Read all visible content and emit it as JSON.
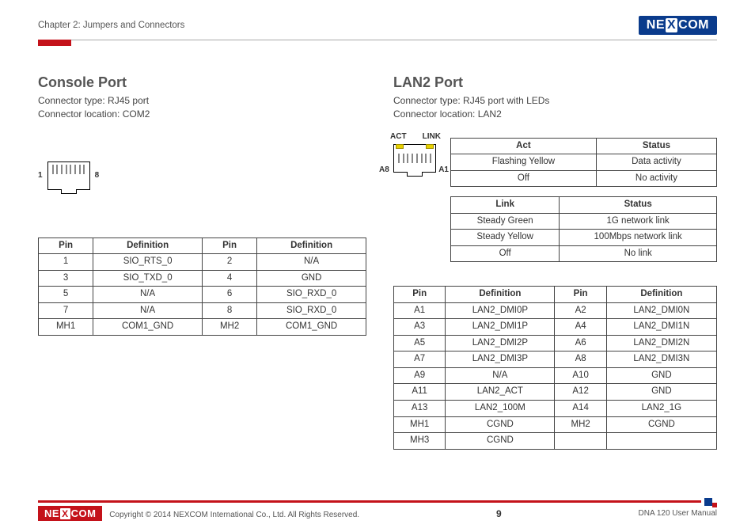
{
  "header": {
    "chapter": "Chapter 2: Jumpers and Connectors",
    "brand": "NEXCOM"
  },
  "console": {
    "title": "Console Port",
    "type": "Connector type: RJ45 port",
    "loc": "Connector location: COM2",
    "pin_left": "1",
    "pin_right": "8",
    "cols": [
      "Pin",
      "Definition",
      "Pin",
      "Definition"
    ],
    "rows": [
      [
        "1",
        "SIO_RTS_0",
        "2",
        "N/A"
      ],
      [
        "3",
        "SIO_TXD_0",
        "4",
        "GND"
      ],
      [
        "5",
        "N/A",
        "6",
        "SIO_RXD_0"
      ],
      [
        "7",
        "N/A",
        "8",
        "SIO_RXD_0"
      ],
      [
        "MH1",
        "COM1_GND",
        "MH2",
        "COM1_GND"
      ]
    ]
  },
  "lan": {
    "title": "LAN2 Port",
    "type": "Connector type: RJ45 port with LEDs",
    "loc": "Connector location: LAN2",
    "lbl_act": "ACT",
    "lbl_link": "LINK",
    "lbl_a8": "A8",
    "lbl_a1": "A1",
    "act_cols": [
      "Act",
      "Status"
    ],
    "act_rows": [
      [
        "Flashing Yellow",
        "Data activity"
      ],
      [
        "Off",
        "No activity"
      ]
    ],
    "link_cols": [
      "Link",
      "Status"
    ],
    "link_rows": [
      [
        "Steady Green",
        "1G network link"
      ],
      [
        "Steady Yellow",
        "100Mbps network link"
      ],
      [
        "Off",
        "No link"
      ]
    ],
    "pin_cols": [
      "Pin",
      "Definition",
      "Pin",
      "Definition"
    ],
    "pin_rows": [
      [
        "A1",
        "LAN2_DMI0P",
        "A2",
        "LAN2_DMI0N"
      ],
      [
        "A3",
        "LAN2_DMI1P",
        "A4",
        "LAN2_DMI1N"
      ],
      [
        "A5",
        "LAN2_DMI2P",
        "A6",
        "LAN2_DMI2N"
      ],
      [
        "A7",
        "LAN2_DMI3P",
        "A8",
        "LAN2_DMI3N"
      ],
      [
        "A9",
        "N/A",
        "A10",
        "GND"
      ],
      [
        "A11",
        "LAN2_ACT",
        "A12",
        "GND"
      ],
      [
        "A13",
        "LAN2_100M",
        "A14",
        "LAN2_1G"
      ],
      [
        "MH1",
        "CGND",
        "MH2",
        "CGND"
      ],
      [
        "MH3",
        "CGND",
        "",
        ""
      ]
    ]
  },
  "footer": {
    "copyright": "Copyright © 2014 NEXCOM International Co., Ltd. All Rights Reserved.",
    "page": "9",
    "doc": "DNA 120 User Manual"
  }
}
